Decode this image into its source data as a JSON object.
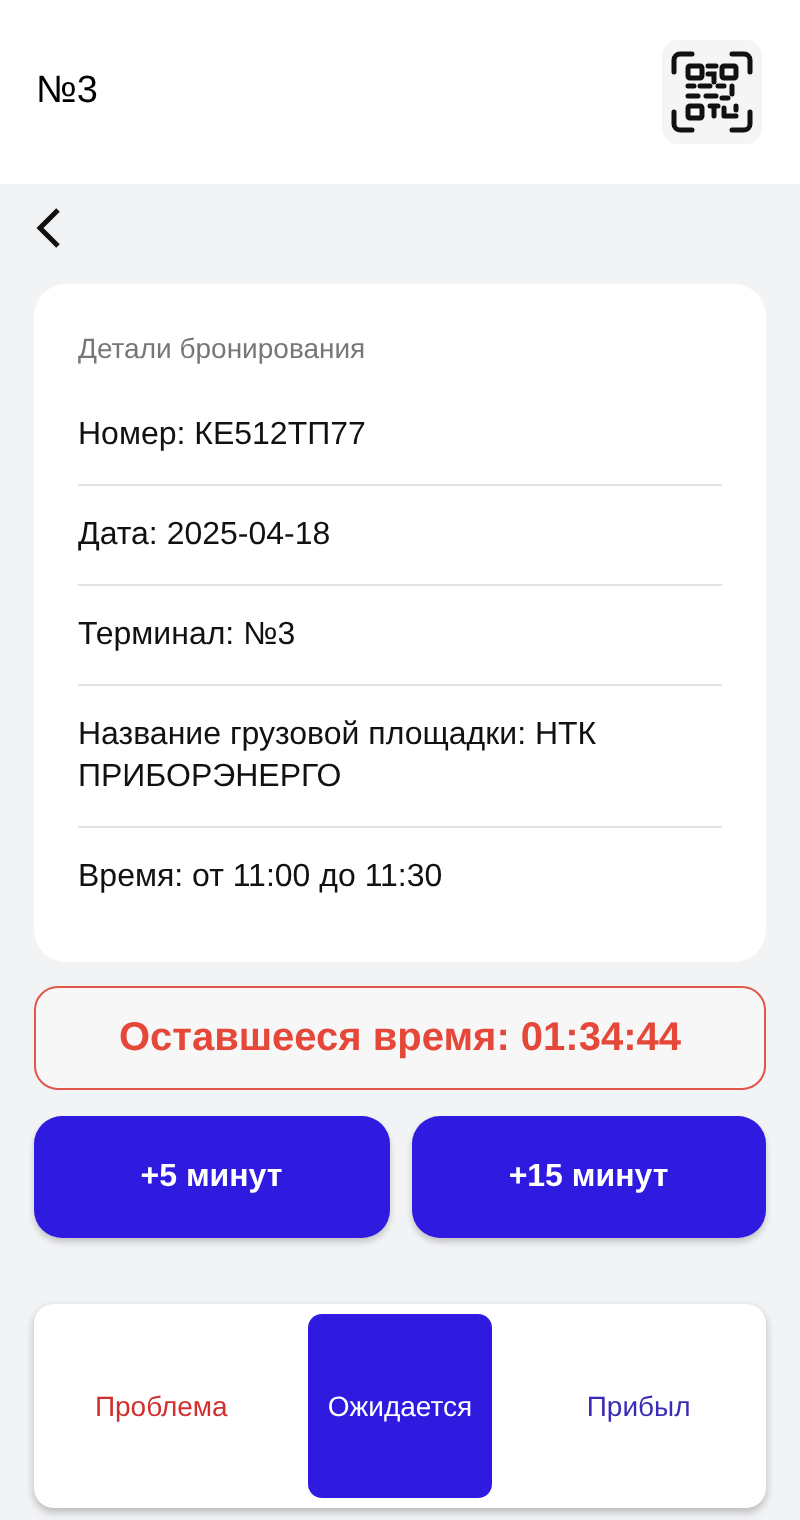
{
  "header": {
    "title": "№3"
  },
  "details": {
    "heading": "Детали бронирования",
    "rows": [
      "Номер: КЕ512ТП77",
      "Дата: 2025-04-18",
      "Терминал: №3",
      "Название грузовой площадки: НТК ПРИБОРЭНЕРГО",
      "Время: от 11:00 до 11:30"
    ]
  },
  "timer": {
    "text": "Оставшееся время: 01:34:44"
  },
  "extend_buttons": [
    "+5 минут",
    "+15 минут"
  ],
  "status_options": [
    {
      "label": "Проблема",
      "selected": false,
      "color": "#d32f2f"
    },
    {
      "label": "Ожидается",
      "selected": true,
      "color": "#2f1ae0"
    },
    {
      "label": "Прибыл",
      "selected": false,
      "color": "#3a2bb5"
    }
  ]
}
